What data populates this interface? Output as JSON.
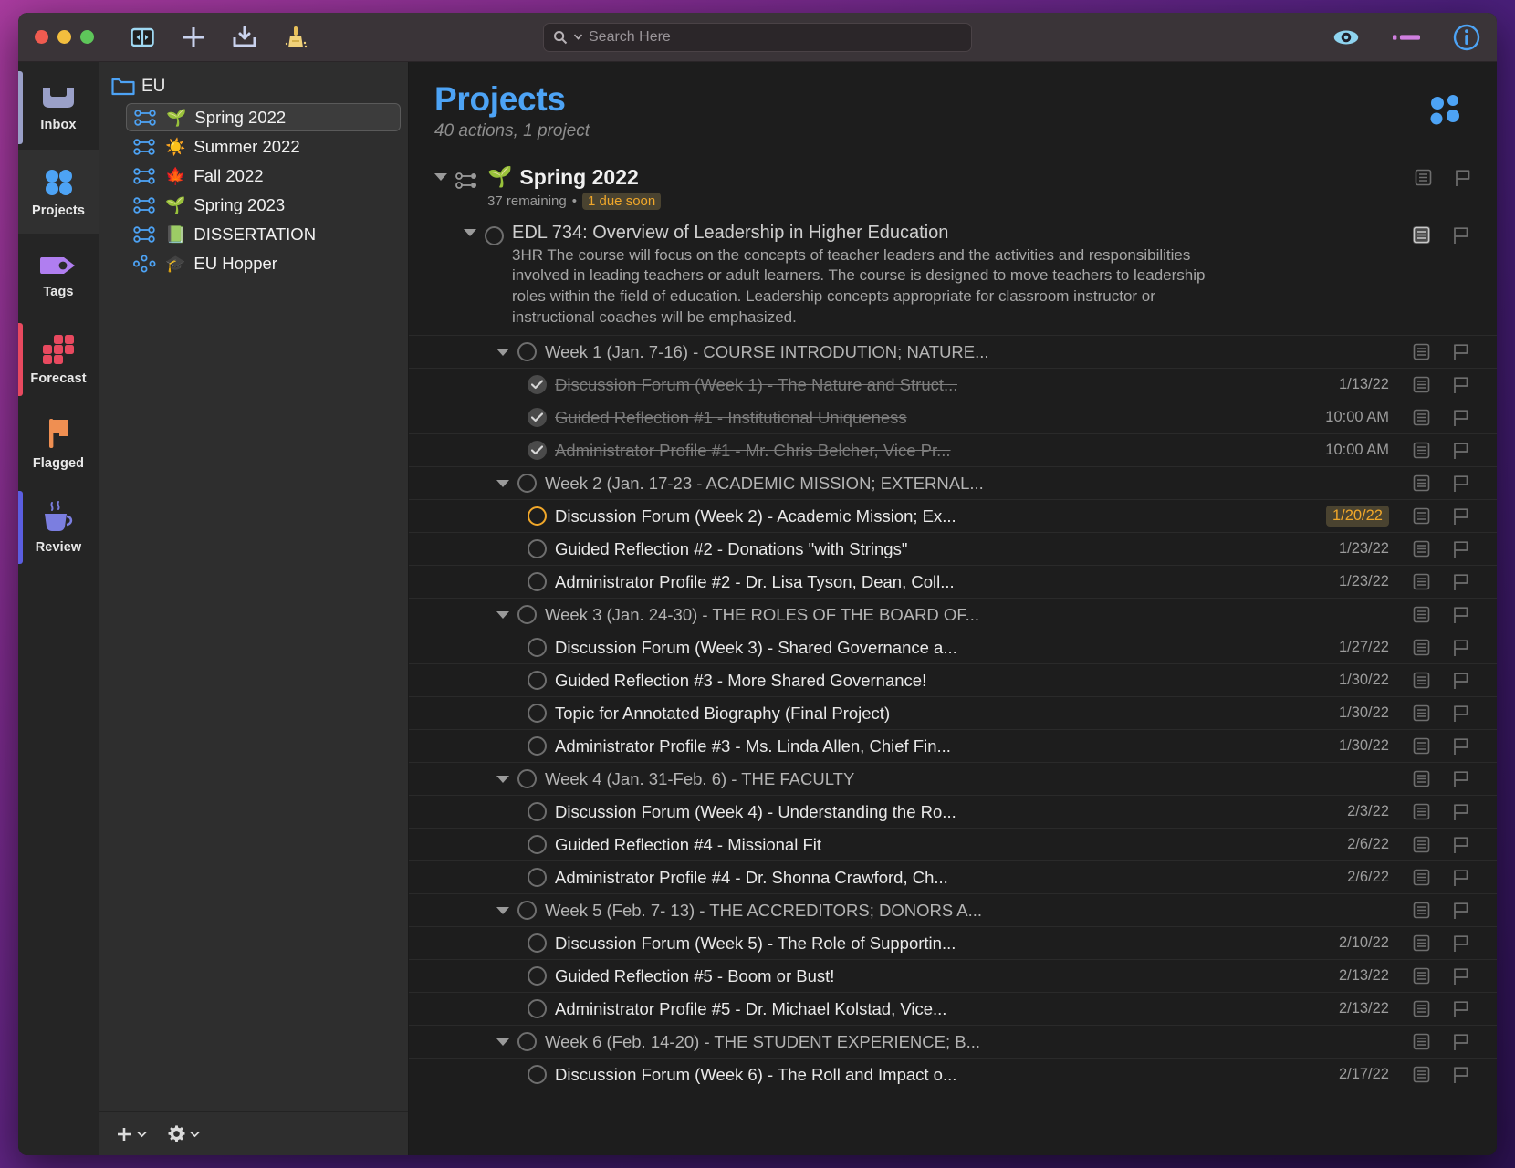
{
  "titlebar": {
    "search_placeholder": "Search Here",
    "buttons": [
      {
        "name": "sidebar-toggle",
        "label": "Toggle Sidebar"
      },
      {
        "name": "add-item",
        "label": "New Item"
      },
      {
        "name": "inbox-download",
        "label": "Inbox"
      },
      {
        "name": "cleanup",
        "label": "Clean Up"
      }
    ],
    "right_buttons": [
      {
        "name": "view-options",
        "label": "View"
      },
      {
        "name": "perspective-stripe",
        "label": "Perspective"
      },
      {
        "name": "inspector",
        "label": "Inspector"
      }
    ]
  },
  "rail": {
    "items": [
      {
        "label": "Inbox",
        "icon": "inbox-icon",
        "color": "#9aa0c8",
        "active": false,
        "accent": "#9aa0c8"
      },
      {
        "label": "Projects",
        "icon": "projects-icon",
        "color": "#4da3f5",
        "active": true,
        "accent": ""
      },
      {
        "label": "Tags",
        "icon": "tags-icon",
        "color": "#b07ef0",
        "active": false,
        "accent": ""
      },
      {
        "label": "Forecast",
        "icon": "forecast-icon",
        "color": "#e8495f",
        "active": false,
        "accent": "#e8495f"
      },
      {
        "label": "Flagged",
        "icon": "flag-icon",
        "color": "#ef8f52",
        "active": false,
        "accent": ""
      },
      {
        "label": "Review",
        "icon": "review-icon",
        "color": "#7b7ee0",
        "active": false,
        "accent": "#5b5ee0"
      }
    ]
  },
  "sidebar": {
    "folder": "EU",
    "projects": [
      {
        "emoji": "🌱",
        "name": "Spring 2022",
        "type": "sequential",
        "selected": true
      },
      {
        "emoji": "☀️",
        "name": "Summer 2022",
        "type": "sequential",
        "selected": false
      },
      {
        "emoji": "🍁",
        "name": "Fall 2022",
        "type": "sequential",
        "selected": false
      },
      {
        "emoji": "🌱",
        "name": "Spring 2023",
        "type": "sequential",
        "selected": false
      },
      {
        "emoji": "📗",
        "name": "DISSERTATION",
        "type": "sequential",
        "selected": false
      },
      {
        "emoji": "🎓",
        "name": "EU Hopper",
        "type": "parallel",
        "selected": false
      }
    ],
    "footer": {
      "add": "Add",
      "settings": "Settings"
    }
  },
  "main": {
    "title": "Projects",
    "subtitle": "40 actions, 1 project",
    "group": {
      "emoji": "🌱",
      "title": "Spring 2022",
      "remaining": "37 remaining",
      "separator": "•",
      "due_soon": "1 due soon"
    },
    "course": {
      "title": "EDL 734: Overview of Leadership in Higher Education",
      "note": "3HR  The course will focus on the concepts of teacher leaders and the activities and responsibilities involved in leading teachers or adult learners. The course is designed to move teachers to leadership roles within the field of education. Leadership concepts appropriate for classroom instructor or instructional coaches will be emphasized."
    },
    "rows": [
      {
        "kind": "week",
        "level": 2,
        "title": "Week 1 (Jan. 7-16) - COURSE INTRODUTION; NATURE...",
        "date": "",
        "state": "open"
      },
      {
        "kind": "task",
        "level": 3,
        "title": "Discussion Forum (Week 1) - The Nature and Struct...",
        "date": "1/13/22",
        "state": "done"
      },
      {
        "kind": "task",
        "level": 3,
        "title": "Guided Reflection #1 - Institutional Uniqueness",
        "date": "10:00 AM",
        "state": "done"
      },
      {
        "kind": "task",
        "level": 3,
        "title": "Administrator Profile #1 - Mr. Chris Belcher, Vice Pr...",
        "date": "10:00 AM",
        "state": "done"
      },
      {
        "kind": "week",
        "level": 2,
        "title": "Week 2 (Jan. 17-23 - ACADEMIC MISSION; EXTERNAL...",
        "date": "",
        "state": "open"
      },
      {
        "kind": "task",
        "level": 3,
        "title": "Discussion Forum (Week 2) - Academic Mission; Ex...",
        "date": "1/20/22",
        "state": "due"
      },
      {
        "kind": "task",
        "level": 3,
        "title": "Guided Reflection #2 - Donations \"with Strings\"",
        "date": "1/23/22",
        "state": "open"
      },
      {
        "kind": "task",
        "level": 3,
        "title": "Administrator Profile #2 - Dr. Lisa Tyson, Dean, Coll...",
        "date": "1/23/22",
        "state": "open"
      },
      {
        "kind": "week",
        "level": 2,
        "title": "Week 3 (Jan. 24-30) - THE ROLES OF THE BOARD OF...",
        "date": "",
        "state": "open"
      },
      {
        "kind": "task",
        "level": 3,
        "title": "Discussion Forum (Week 3) - Shared Governance a...",
        "date": "1/27/22",
        "state": "open"
      },
      {
        "kind": "task",
        "level": 3,
        "title": "Guided Reflection #3 - More Shared Governance!",
        "date": "1/30/22",
        "state": "open"
      },
      {
        "kind": "task",
        "level": 3,
        "title": "Topic for Annotated Biography (Final Project)",
        "date": "1/30/22",
        "state": "open"
      },
      {
        "kind": "task",
        "level": 3,
        "title": "Administrator Profile #3 - Ms. Linda Allen, Chief Fin...",
        "date": "1/30/22",
        "state": "open"
      },
      {
        "kind": "week",
        "level": 2,
        "title": "Week 4 (Jan. 31-Feb. 6) - THE FACULTY",
        "date": "",
        "state": "open"
      },
      {
        "kind": "task",
        "level": 3,
        "title": "Discussion Forum (Week 4) - Understanding the Ro...",
        "date": "2/3/22",
        "state": "open"
      },
      {
        "kind": "task",
        "level": 3,
        "title": "Guided Reflection #4 - Missional Fit",
        "date": "2/6/22",
        "state": "open"
      },
      {
        "kind": "task",
        "level": 3,
        "title": "Administrator Profile #4 - Dr. Shonna Crawford, Ch...",
        "date": "2/6/22",
        "state": "open"
      },
      {
        "kind": "week",
        "level": 2,
        "title": "Week 5 (Feb. 7- 13) - THE ACCREDITORS; DONORS A...",
        "date": "",
        "state": "open"
      },
      {
        "kind": "task",
        "level": 3,
        "title": "Discussion Forum (Week 5) - The Role of Supportin...",
        "date": "2/10/22",
        "state": "open"
      },
      {
        "kind": "task",
        "level": 3,
        "title": "Guided Reflection #5 - Boom or Bust!",
        "date": "2/13/22",
        "state": "open"
      },
      {
        "kind": "task",
        "level": 3,
        "title": "Administrator Profile #5 - Dr. Michael Kolstad, Vice...",
        "date": "2/13/22",
        "state": "open"
      },
      {
        "kind": "week",
        "level": 2,
        "title": "Week 6 (Feb. 14-20) - THE STUDENT EXPERIENCE; B...",
        "date": "",
        "state": "open"
      },
      {
        "kind": "task",
        "level": 3,
        "title": "Discussion Forum (Week 6) - The Roll and Impact o...",
        "date": "2/17/22",
        "state": "open"
      }
    ]
  },
  "colors": {
    "accent_blue": "#4da3f5",
    "due_orange": "#f0a72a",
    "window_bg": "#1d1d1d",
    "sidebar_bg": "#2e2e2e",
    "titlebar_bg": "#3a3438"
  }
}
